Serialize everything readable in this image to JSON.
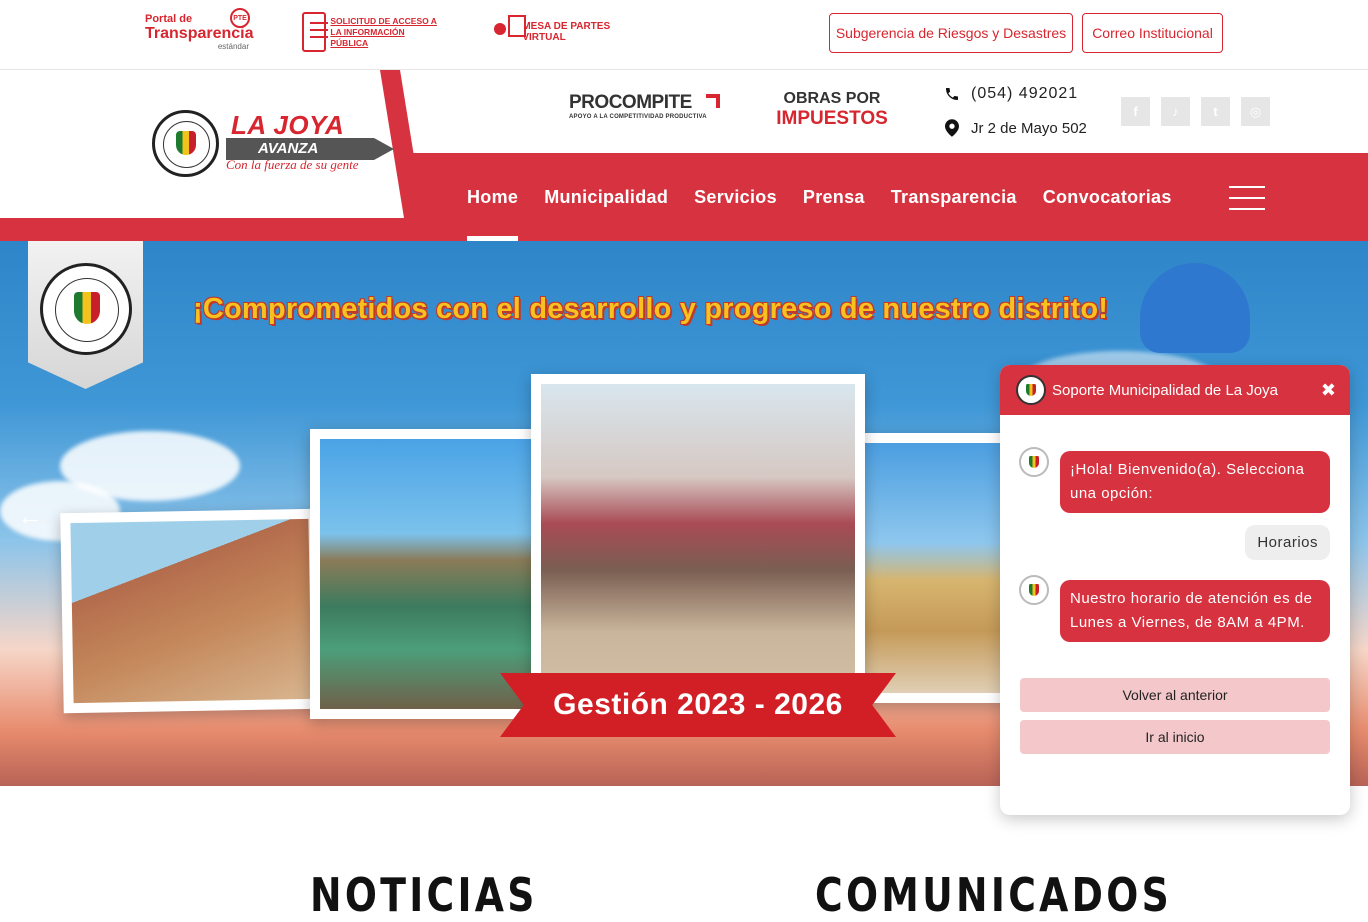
{
  "topbar": {
    "pte": {
      "line1": "Portal de",
      "line2": "Transparencia",
      "line3": "estándar",
      "badge": "PTE"
    },
    "sai": {
      "text": "SOLICITUD DE ACCESO A LA INFORMACIÓN PÚBLICA"
    },
    "mpv": {
      "text": "MESA DE PARTES VIRTUAL"
    },
    "buttons": [
      "Subgerencia de Riesgos y Desastres",
      "Correo Institucional"
    ]
  },
  "header": {
    "brand": {
      "name": "LA JOYA",
      "tagline_box": "AVANZA",
      "slogan": "Con la fuerza de su gente"
    },
    "procompite": {
      "part1": "PRO",
      "part2": "COMPITE",
      "sub": "APOYO A LA COMPETITIVIDAD PRODUCTIVA"
    },
    "obras": {
      "line1": "OBRAS POR",
      "line2": "IMPUESTOS"
    },
    "phone": "(054) 492021",
    "address": "Jr 2 de Mayo 502",
    "socials": [
      {
        "icon": "facebook-icon",
        "glyph": "f"
      },
      {
        "icon": "tiktok-icon",
        "glyph": "♪"
      },
      {
        "icon": "twitter-icon",
        "glyph": "t"
      },
      {
        "icon": "instagram-icon",
        "glyph": "◎"
      }
    ]
  },
  "nav": {
    "items": [
      "Home",
      "Municipalidad",
      "Servicios",
      "Prensa",
      "Transparencia",
      "Convocatorias"
    ],
    "active": "Home"
  },
  "hero": {
    "headline": "¡Comprometidos con el desarrollo y progreso de nuestro distrito!",
    "ribbon": "Gestión 2023 - 2026",
    "prev_arrow": "←"
  },
  "chat": {
    "title": "Soporte Municipalidad de La Joya",
    "close": "✖",
    "messages": [
      {
        "from": "bot",
        "text": "¡Hola! Bienvenido(a). Selecciona una opción:"
      },
      {
        "from": "user",
        "text": "Horarios"
      },
      {
        "from": "bot",
        "text": "Nuestro horario de atención es de Lunes a Viernes, de 8AM a 4PM."
      }
    ],
    "options": [
      "Volver al anterior",
      "Ir al inicio"
    ]
  },
  "sections": {
    "news": "NOTICIAS",
    "announcements": "COMUNICADOS"
  },
  "colors": {
    "brand_red": "#d7323f",
    "accent_yellow": "#f7c11f"
  }
}
